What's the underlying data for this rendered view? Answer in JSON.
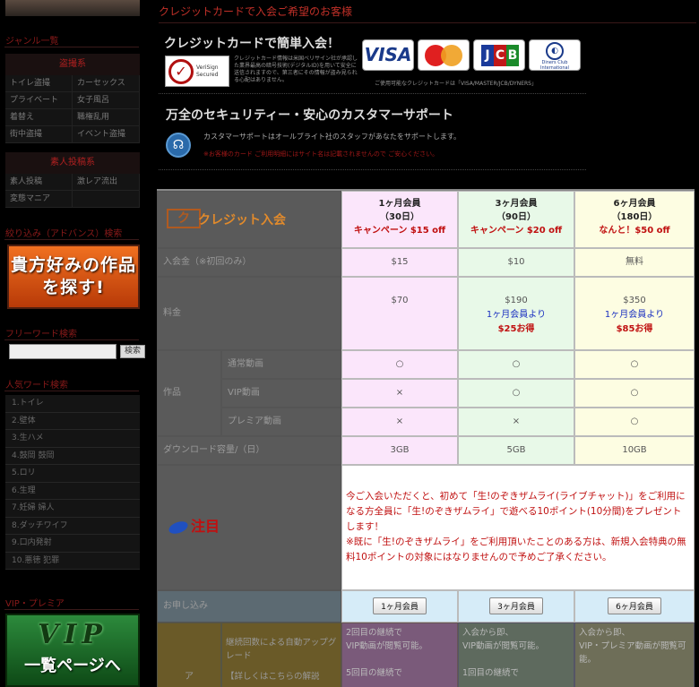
{
  "sidebar": {
    "genre_title": "ジャンル一覧",
    "tousatsu_label": "盗撮系",
    "tousatsu_items": [
      "トイレ盗撮",
      "カーセックス",
      "プライベート",
      "女子風呂",
      "着替え",
      "職権乱用",
      "街中盗撮",
      "イベント盗撮"
    ],
    "amateur_label": "素人投稿系",
    "amateur_items": [
      "素人投稿",
      "激レア流出",
      "変態マニア"
    ],
    "advanced_title": "絞り込み（アドバンス）検索",
    "find_button": "貴方好みの作品を探す!",
    "freeword_title": "フリーワード検索",
    "search_button": "検索",
    "popular_title": "人気ワード検索",
    "popular_items": [
      "1.トイレ",
      "2.壁体",
      "3.生ハメ",
      "4.鼓岡 鼓岡",
      "5.ロリ",
      "6.生理",
      "7.妊婦 婦人",
      "8.ダッチワイフ",
      "9.口内発射",
      "10.悪徳 犯罪"
    ],
    "vip_title": "VIP・プレミア",
    "vip_big": "VIP",
    "vip_small": "一覧ページへ"
  },
  "main": {
    "title": "クレジットカードで入会ご希望のお客様",
    "sec1_title": "クレジットカードで簡単入会！",
    "verisign_text": "VeriSign Secured",
    "sec1_desc": "クレジットカード情報は米国ベリサイン社が承認した業界最高の暗号技術(デジタルID)を用いて安全に送信されますので、第三者にその情報が盗み見られる心配はありません。",
    "cards": [
      "VISA",
      "MasterCard",
      "JCB",
      "Diners Club International"
    ],
    "cards_note": "ご使用可能なクレジットカードは「VISA/MASTER/JCB/DYNERS」",
    "sec2_title": "万全のセキュリティー・安心のカスタマーサポート",
    "sec2_desc": "カスタマーサポートはオールブライト社のスタッフがあなたをサポートします。",
    "sec2_warn": "※お客様のカード ご利用明細にはサイト名は記載されませんので ご安心ください。"
  },
  "table": {
    "logo_text": "クレジット入会",
    "plans": [
      {
        "name": "1ヶ月会員",
        "days": "（30日）",
        "campaign": "キャンペーン $15 off"
      },
      {
        "name": "3ヶ月会員",
        "days": "（90日）",
        "campaign": "キャンペーン $20 off"
      },
      {
        "name": "6ヶ月会員",
        "days": "（180日）",
        "campaign": "なんと！$50 off"
      }
    ],
    "fee_label": "入会金（※初回のみ）",
    "fees": [
      "$15",
      "$10",
      "無料"
    ],
    "price_label": "料金",
    "prices": [
      "$70",
      "$190",
      "$350"
    ],
    "compare_text": "1ヶ月会員より",
    "savings": [
      "$25お得",
      "$85お得"
    ],
    "works_label": "作品",
    "works_rows": [
      {
        "name": "通常動画",
        "values": [
          "○",
          "○",
          "○"
        ]
      },
      {
        "name": "VIP動画",
        "values": [
          "×",
          "○",
          "○"
        ]
      },
      {
        "name": "プレミア動画",
        "values": [
          "×",
          "×",
          "○"
        ]
      }
    ],
    "download_label": "ダウンロード容量/（日）",
    "downloads": [
      "3GB",
      "5GB",
      "10GB"
    ],
    "attention_label": "注目",
    "notice_line1": "今ご入会いただくと、初めて「生!のぞきザムライ(ライブチャット)」をご利用になる方全員に「生!のぞきザムライ」で遊べる10ポイント(10分間)をプレゼントします！",
    "notice_line2": "※既に「生!のぞきザムライ」をご利用頂いたことのある方は、新規入会特典の無料10ポイントの対象にはなりませんので予めご了承ください。",
    "apply_label": "お申し込み",
    "apply_buttons": [
      "1ヶ月会員",
      "3ヶ月会員",
      "6ヶ月会員"
    ],
    "auto_side": "ア",
    "auto_label": "継続回数による自動アップグレード",
    "auto_label2": "【詳しくはこちらの解説",
    "auto_texts": [
      "2回目の継続で\nVIP動画が閲覧可能。\n\n5回目の継続で",
      "入会から即、\nVIP動画が閲覧可能。\n\n1回目の継続で",
      "入会から即、\nVIP・プレミア動画が閲覧可能。"
    ]
  }
}
